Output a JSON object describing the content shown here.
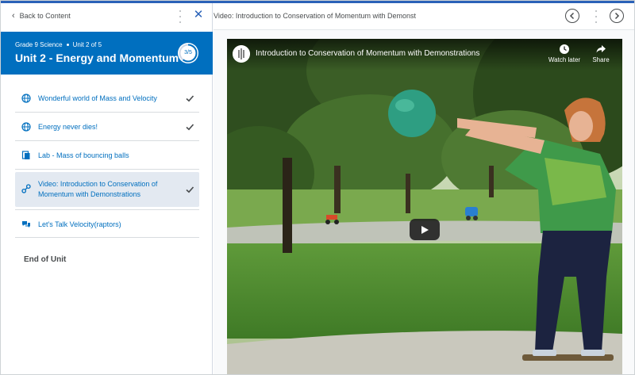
{
  "sidebar": {
    "back_label": "Back to Content",
    "unit": {
      "course": "Grade 9 Science",
      "position": "Unit 2 of 5",
      "title": "Unit 2 - Energy and Momentum",
      "progress_label": "3/5",
      "progress_fraction": 0.6
    },
    "items": [
      {
        "label": "Wonderful world of Mass and Velocity",
        "icon": "globe-icon",
        "completed": true
      },
      {
        "label": "Energy never dies!",
        "icon": "globe-icon",
        "completed": true
      },
      {
        "label": "Lab - Mass of bouncing balls",
        "icon": "document-icon",
        "completed": false
      },
      {
        "label": "Video: Introduction to Conservation of Momentum with Demonstrations",
        "icon": "link-icon",
        "completed": true,
        "active": true
      },
      {
        "label": "Let's Talk Velocity(raptors)",
        "icon": "discussion-icon",
        "completed": false
      }
    ],
    "end_label": "End of Unit"
  },
  "main": {
    "title": "Video: Introduction to Conservation of Momentum with Demonst",
    "video": {
      "title": "Introduction to Conservation of Momentum with Demonstrations",
      "watch_later": "Watch later",
      "share": "Share"
    }
  },
  "colors": {
    "brand": "#006fbf",
    "accent": "#2a62b8",
    "active_bg": "#e3e9f1"
  }
}
